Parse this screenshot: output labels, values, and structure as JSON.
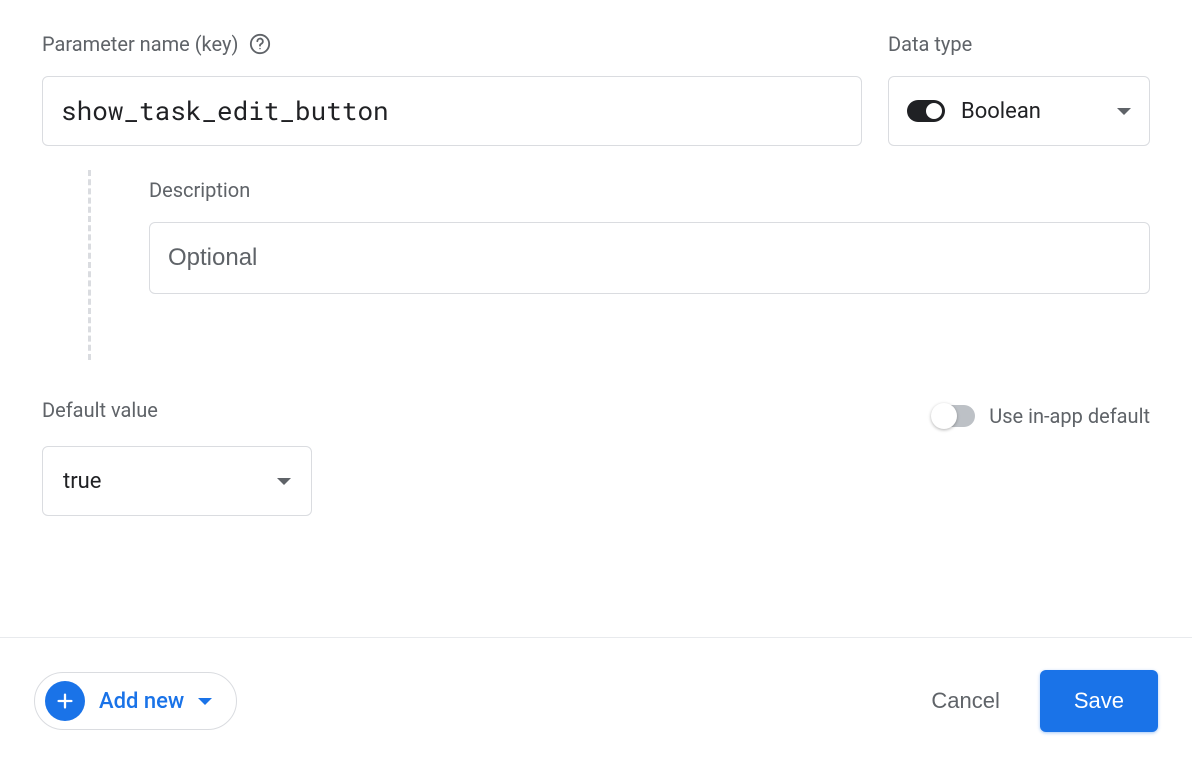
{
  "param": {
    "label": "Parameter name (key)",
    "value": "show_task_edit_button"
  },
  "dataType": {
    "label": "Data type",
    "selected": "Boolean"
  },
  "description": {
    "label": "Description",
    "placeholder": "Optional",
    "value": ""
  },
  "defaultValue": {
    "label": "Default value",
    "selected": "true"
  },
  "inAppDefault": {
    "label": "Use in-app default",
    "enabled": false
  },
  "footer": {
    "addNew": "Add new",
    "cancel": "Cancel",
    "save": "Save"
  }
}
